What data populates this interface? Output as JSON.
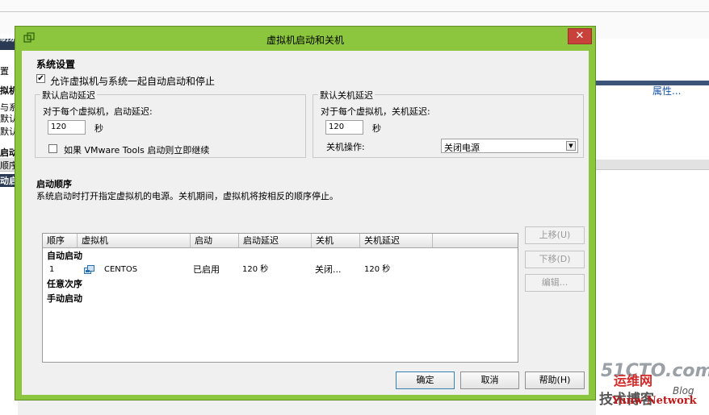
{
  "background": {
    "left_texts": [
      "制余",
      "置",
      "拟机",
      "与系",
      "默认",
      "默认",
      "启动",
      "顺序",
      "动启"
    ],
    "right_link": "属性...",
    "watermark": {
      "site": "51CTO.com",
      "cn_top": "运维网",
      "cn_bottom": "技术博客",
      "blog": "Blog",
      "network": "Yunw Network"
    }
  },
  "dialog": {
    "title": "虚拟机启动和关机",
    "close_label": "✕",
    "system_settings": {
      "heading": "系统设置",
      "allow_autostart": {
        "checked": true,
        "label": "允许虚拟机与系统一起自动启动和停止"
      }
    },
    "startup_delay": {
      "heading": "默认启动延迟",
      "per_vm_label": "对于每个虚拟机，启动延迟:",
      "value": "120",
      "unit": "秒",
      "tools_continue": {
        "checked": false,
        "label": "如果 VMware Tools 启动则立即继续"
      }
    },
    "shutdown_delay": {
      "heading": "默认关机延迟",
      "per_vm_label": "对于每个虚拟机，关机延迟:",
      "value": "120",
      "unit": "秒",
      "action_label": "关机操作:",
      "action_value": "关闭电源"
    },
    "startup_order": {
      "heading": "启动顺序",
      "description": "系统启动时打开指定虚拟机的电源。关机期间，虚拟机将按相反的顺序停止。",
      "columns": [
        "顺序",
        "虚拟机",
        "启动",
        "启动延迟",
        "关机",
        "关机延迟"
      ],
      "group_auto": "自动启动",
      "group_any": "任意次序",
      "group_manual": "手动启动",
      "rows": [
        {
          "order": "1",
          "vm": "CENTOS",
          "startup": "已启用",
          "startup_delay": "120 秒",
          "shutdown": "关闭...",
          "shutdown_delay": "120 秒"
        }
      ]
    },
    "side_buttons": {
      "move_up": "上移(U)",
      "move_down": "下移(D)",
      "edit": "编辑..."
    },
    "footer_buttons": {
      "ok": "确定",
      "cancel": "取消",
      "help": "帮助(H)"
    }
  }
}
